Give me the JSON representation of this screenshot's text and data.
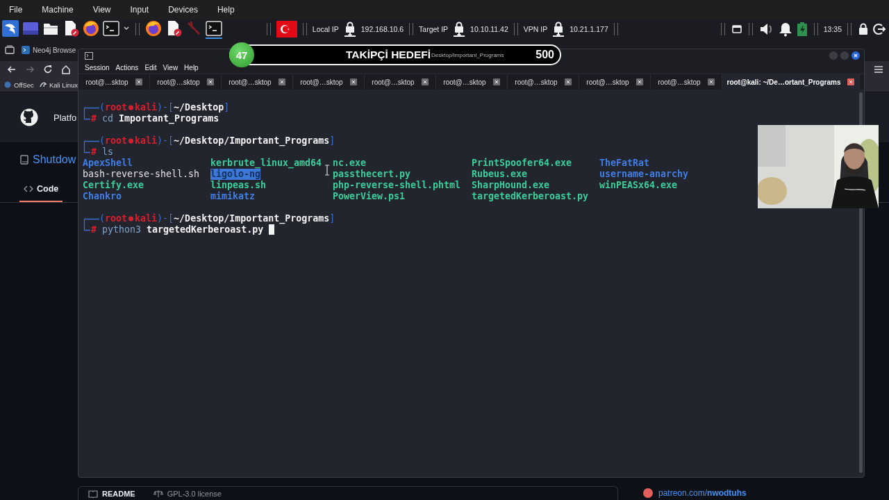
{
  "host_menu": [
    "File",
    "Machine",
    "View",
    "Input",
    "Devices",
    "Help"
  ],
  "panel": {
    "launchers": [
      {
        "kind": "menu",
        "active": false
      },
      {
        "kind": "workspaces",
        "active": false
      },
      {
        "kind": "folder",
        "active": false
      },
      {
        "kind": "editor",
        "active": false
      },
      {
        "kind": "firefox",
        "active": false
      },
      {
        "kind": "terminal",
        "active": false
      },
      {
        "kind": "dropdown",
        "active": false
      },
      {
        "kind": "firefox",
        "active": false
      },
      {
        "kind": "editor",
        "active": false
      },
      {
        "kind": "tool",
        "active": false
      },
      {
        "kind": "terminal",
        "active": true
      }
    ],
    "ip_widgets": [
      {
        "label": "Local IP",
        "value": "192.168.10.6"
      },
      {
        "label": "Target IP",
        "value": "10.10.11.42"
      },
      {
        "label": "VPN IP",
        "value": "10.21.1.177"
      }
    ],
    "clock": "13:35"
  },
  "browser": {
    "tab": "Neo4j Browse",
    "nav": [
      {
        "kind": "back",
        "disabled": false
      },
      {
        "kind": "forward",
        "disabled": true
      },
      {
        "kind": "reload",
        "disabled": false
      },
      {
        "kind": "home",
        "disabled": false
      }
    ],
    "bookmarks": [
      "OffSec",
      "Kali Linux"
    ],
    "site_nav": "Platfo",
    "repo": "Shutdow",
    "repo_tabs": [
      {
        "label": "Code",
        "selected": true
      }
    ],
    "readme_tabs": [
      "README",
      "GPL-3.0 license"
    ],
    "sponsor_link": "patreon.com/**nwodtuhs**"
  },
  "stream_goal": {
    "current": "47",
    "title": "TAKİPÇİ HEDEFİ",
    "target": "500"
  },
  "terminal": {
    "title": "Desktop/Important_Programs",
    "menu": [
      "Session",
      "Actions",
      "Edit",
      "View",
      "Help"
    ],
    "tabs": [
      {
        "label": "root@…sktop",
        "selected": false
      },
      {
        "label": "root@…sktop",
        "selected": false
      },
      {
        "label": "root@…sktop",
        "selected": false
      },
      {
        "label": "root@…sktop",
        "selected": false
      },
      {
        "label": "root@…sktop",
        "selected": false
      },
      {
        "label": "root@…sktop",
        "selected": false
      },
      {
        "label": "root@…sktop",
        "selected": false
      },
      {
        "label": "root@…sktop",
        "selected": false
      },
      {
        "label": "root@…sktop",
        "selected": false
      },
      {
        "label": "root@kali: ~/De…ortant_Programs",
        "selected": true
      }
    ],
    "blocks": [
      {
        "kind": "prompt",
        "cursor": false,
        "header": [
          "(",
          "root",
          "kali",
          ")-[",
          "~/Desktop",
          "]"
        ],
        "command": [
          "#",
          " cd",
          " Important_Programs"
        ]
      },
      {
        "kind": "prompt",
        "cursor": false,
        "header": [
          "(",
          "root",
          "kali",
          ")-[",
          "~/Desktop/Important_Programs",
          "]"
        ],
        "command": [
          "#",
          " ls"
        ]
      },
      {
        "kind": "listing",
        "columns": [
          [
            {
              "name": "ApexShell",
              "kind": "dir",
              "selected": false
            },
            {
              "name": "bash-reverse-shell.sh",
              "kind": "file",
              "selected": false
            },
            {
              "name": "Certify.exe",
              "kind": "exec",
              "selected": false
            },
            {
              "name": "Chankro",
              "kind": "dir",
              "selected": false
            }
          ],
          [
            {
              "name": "kerbrute_linux_amd64",
              "kind": "exec",
              "selected": false
            },
            {
              "name": "ligolo-ng",
              "kind": "dir",
              "selected": true
            },
            {
              "name": "linpeas.sh",
              "kind": "exec",
              "selected": false
            },
            {
              "name": "mimikatz",
              "kind": "dir",
              "selected": false
            }
          ],
          [
            {
              "name": "nc.exe",
              "kind": "exec",
              "selected": false
            },
            {
              "name": "passthecert.py",
              "kind": "exec",
              "selected": false
            },
            {
              "name": "php-reverse-shell.phtml",
              "kind": "exec",
              "selected": false
            },
            {
              "name": "PowerView.ps1",
              "kind": "exec",
              "selected": false
            }
          ],
          [
            {
              "name": "PrintSpoofer64.exe",
              "kind": "exec",
              "selected": false
            },
            {
              "name": "Rubeus.exe",
              "kind": "exec",
              "selected": false
            },
            {
              "name": "SharpHound.exe",
              "kind": "exec",
              "selected": false
            },
            {
              "name": "targetedKerberoast.py",
              "kind": "exec",
              "selected": false
            }
          ],
          [
            {
              "name": "TheFatRat",
              "kind": "dir",
              "selected": false
            },
            {
              "name": "username-anarchy",
              "kind": "dir",
              "selected": false
            },
            {
              "name": "winPEASx64.exe",
              "kind": "exec",
              "selected": false
            }
          ]
        ]
      },
      {
        "kind": "prompt",
        "cursor": true,
        "header": [
          "(",
          "root",
          "kali",
          ")-[",
          "~/Desktop/Important_Programs",
          "]"
        ],
        "command": [
          "#",
          " python3",
          " targetedKerberoast.py"
        ]
      }
    ]
  }
}
